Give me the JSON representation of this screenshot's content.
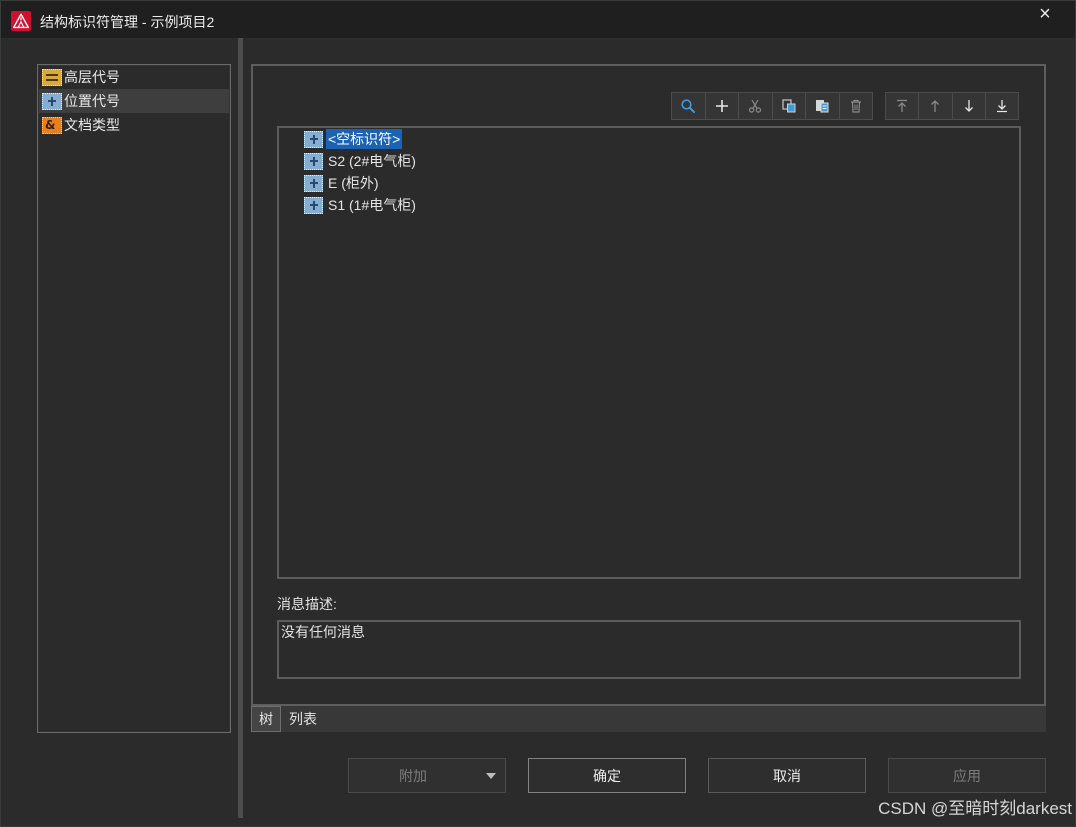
{
  "window": {
    "title": "结构标识符管理 - 示例项目2",
    "app_icon": "app-logo-icon",
    "close_glyph": "×"
  },
  "sidebar": {
    "items": [
      {
        "label": "高层代号",
        "icon": "higher-level-icon",
        "selected": false
      },
      {
        "label": "位置代号",
        "icon": "location-icon",
        "selected": true
      },
      {
        "label": "文档类型",
        "icon": "document-type-icon",
        "icon_glyph": "&",
        "selected": false
      }
    ]
  },
  "toolbar": {
    "group1": [
      {
        "icon": "search-icon",
        "enabled": true
      },
      {
        "icon": "plus-icon",
        "enabled": true
      },
      {
        "icon": "cut-icon",
        "enabled": false
      },
      {
        "icon": "copy-icon",
        "enabled": true
      },
      {
        "icon": "paste-icon",
        "enabled": true
      },
      {
        "icon": "delete-icon",
        "enabled": false
      }
    ],
    "group2": [
      {
        "icon": "move-to-top-icon",
        "enabled": false
      },
      {
        "icon": "move-up-icon",
        "enabled": false
      },
      {
        "icon": "move-down-icon",
        "enabled": true
      },
      {
        "icon": "move-to-bottom-icon",
        "enabled": true
      }
    ]
  },
  "tree": {
    "items": [
      {
        "label": "<空标识符>",
        "icon": "location-icon",
        "selected": true
      },
      {
        "label": "S2 (2#电气柜)",
        "icon": "location-icon",
        "selected": false
      },
      {
        "label": "E (柜外)",
        "icon": "location-icon",
        "selected": false
      },
      {
        "label": "S1 (1#电气柜)",
        "icon": "location-icon",
        "selected": false
      }
    ]
  },
  "message": {
    "label": "消息描述:",
    "text": "没有任何消息"
  },
  "tabs": [
    {
      "label": "树",
      "active": true
    },
    {
      "label": "列表",
      "active": false
    }
  ],
  "footer": {
    "attach": {
      "label": "附加",
      "enabled": false
    },
    "ok": {
      "label": "确定",
      "enabled": true,
      "default": true
    },
    "cancel": {
      "label": "取消",
      "enabled": true
    },
    "apply": {
      "label": "应用",
      "enabled": false
    }
  },
  "watermark": "CSDN @至暗时刻darkest",
  "colors": {
    "window_bg": "#2b2b2b",
    "titlebar_bg": "#1f1f1f",
    "text": "#e3e3e3",
    "disabled_text": "#7c7c7c",
    "selection": "#1a63b4",
    "sidebar_selection": "#3e3e3e",
    "brand": "#d0102d",
    "icon_blue": "#3b9ce0",
    "location_icon": "#86aed3",
    "higher_level_icon": "#d9aa3a",
    "document_type_icon": "#e6801b"
  }
}
